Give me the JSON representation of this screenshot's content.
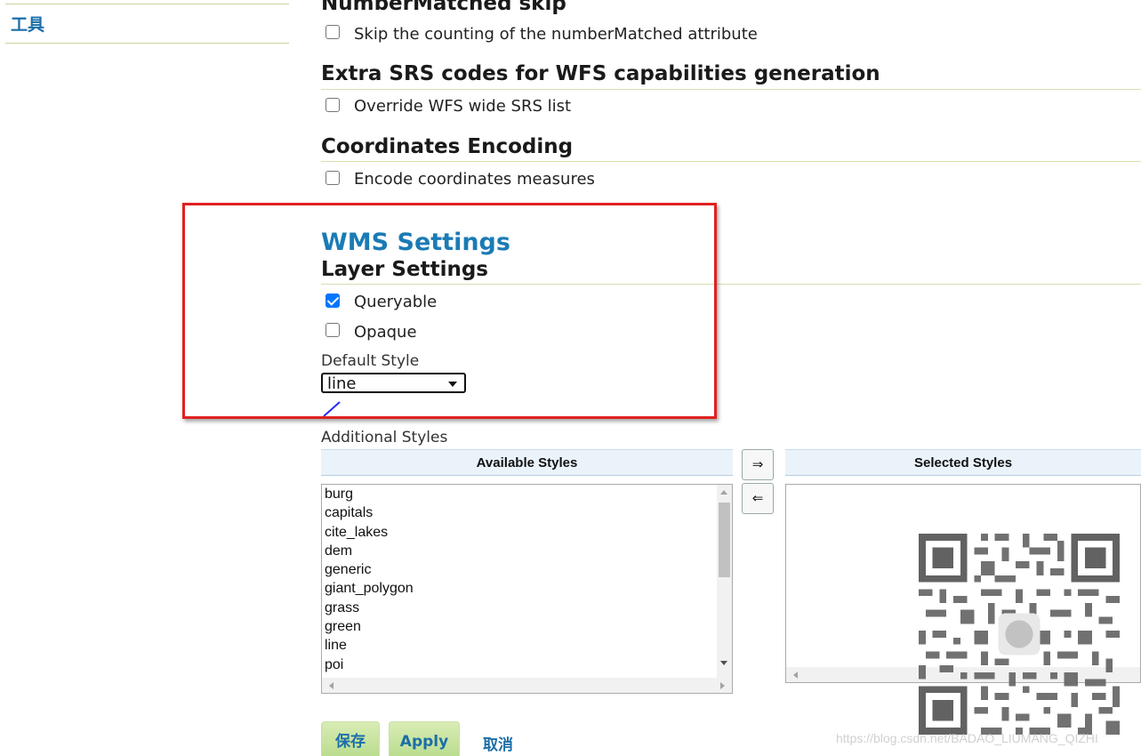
{
  "sidebar": {
    "tools_link": "工具"
  },
  "sections": {
    "number_matched": {
      "title": "NumberMatched skip",
      "checkbox_label": "Skip the counting of the numberMatched attribute",
      "checked": false
    },
    "extra_srs": {
      "title": "Extra SRS codes for WFS capabilities generation",
      "checkbox_label": "Override WFS wide SRS list",
      "checked": false
    },
    "coordinates": {
      "title": "Coordinates Encoding",
      "checkbox_label": "Encode coordinates measures",
      "checked": false
    }
  },
  "wms": {
    "title": "WMS Settings",
    "layer_settings_title": "Layer Settings",
    "queryable_label": "Queryable",
    "queryable_checked": true,
    "opaque_label": "Opaque",
    "opaque_checked": false,
    "default_style_label": "Default Style",
    "default_style_value": "line",
    "additional_styles_label": "Additional Styles"
  },
  "styles": {
    "available_header": "Available Styles",
    "selected_header": "Selected Styles",
    "available": [
      "burg",
      "capitals",
      "cite_lakes",
      "dem",
      "generic",
      "giant_polygon",
      "grass",
      "green",
      "line",
      "poi"
    ],
    "selected": [],
    "move_right_label": "⇒",
    "move_left_label": "⇐"
  },
  "actions": {
    "save": "保存",
    "apply": "Apply",
    "cancel": "取消"
  },
  "watermark": "https://blog.csdn.net/BADAO_LIUMANG_QIZHI",
  "colors": {
    "link_blue": "#1b6ea8",
    "wms_title": "#1b7bb5",
    "highlight_red": "#e02020",
    "button_green": "#c6e39e"
  }
}
